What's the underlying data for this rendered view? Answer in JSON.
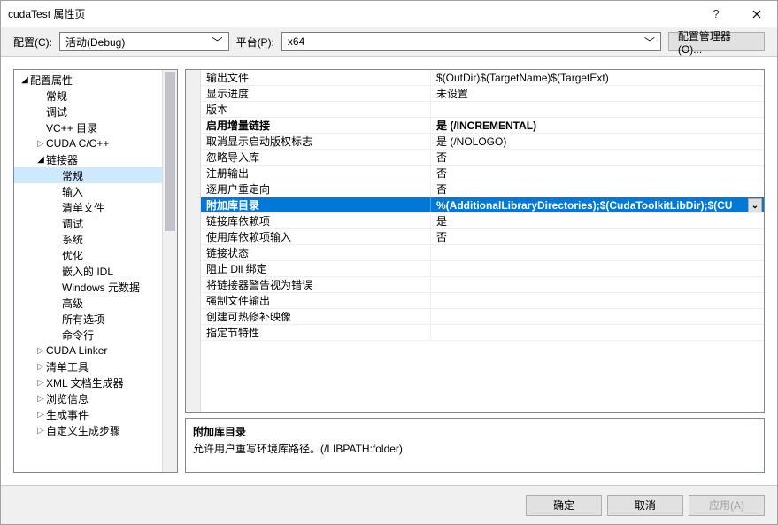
{
  "window": {
    "title": "cudaTest 属性页"
  },
  "toolbar": {
    "config_label": "配置(C):",
    "config_value": "活动(Debug)",
    "platform_label": "平台(P):",
    "platform_value": "x64",
    "manager_label": "配置管理器(O)..."
  },
  "tree": [
    {
      "label": "配置属性",
      "depth": 0,
      "arrow": "open"
    },
    {
      "label": "常规",
      "depth": 1,
      "arrow": ""
    },
    {
      "label": "调试",
      "depth": 1,
      "arrow": ""
    },
    {
      "label": "VC++ 目录",
      "depth": 1,
      "arrow": ""
    },
    {
      "label": "CUDA C/C++",
      "depth": 1,
      "arrow": "closed"
    },
    {
      "label": "链接器",
      "depth": 1,
      "arrow": "open"
    },
    {
      "label": "常规",
      "depth": 2,
      "arrow": "",
      "selected": true
    },
    {
      "label": "输入",
      "depth": 2,
      "arrow": ""
    },
    {
      "label": "清单文件",
      "depth": 2,
      "arrow": ""
    },
    {
      "label": "调试",
      "depth": 2,
      "arrow": ""
    },
    {
      "label": "系统",
      "depth": 2,
      "arrow": ""
    },
    {
      "label": "优化",
      "depth": 2,
      "arrow": ""
    },
    {
      "label": "嵌入的 IDL",
      "depth": 2,
      "arrow": ""
    },
    {
      "label": "Windows 元数据",
      "depth": 2,
      "arrow": ""
    },
    {
      "label": "高级",
      "depth": 2,
      "arrow": ""
    },
    {
      "label": "所有选项",
      "depth": 2,
      "arrow": ""
    },
    {
      "label": "命令行",
      "depth": 2,
      "arrow": ""
    },
    {
      "label": "CUDA Linker",
      "depth": 1,
      "arrow": "closed"
    },
    {
      "label": "清单工具",
      "depth": 1,
      "arrow": "closed"
    },
    {
      "label": "XML 文档生成器",
      "depth": 1,
      "arrow": "closed"
    },
    {
      "label": "浏览信息",
      "depth": 1,
      "arrow": "closed"
    },
    {
      "label": "生成事件",
      "depth": 1,
      "arrow": "closed"
    },
    {
      "label": "自定义生成步骤",
      "depth": 1,
      "arrow": "closed"
    }
  ],
  "grid": [
    {
      "k": "输出文件",
      "v": "$(OutDir)$(TargetName)$(TargetExt)"
    },
    {
      "k": "显示进度",
      "v": "未设置"
    },
    {
      "k": "版本",
      "v": ""
    },
    {
      "k": "启用增量链接",
      "v": "是 (/INCREMENTAL)",
      "bold": true
    },
    {
      "k": "取消显示启动版权标志",
      "v": "是 (/NOLOGO)"
    },
    {
      "k": "忽略导入库",
      "v": "否"
    },
    {
      "k": "注册输出",
      "v": "否"
    },
    {
      "k": "逐用户重定向",
      "v": "否"
    },
    {
      "k": "附加库目录",
      "v": "%(AdditionalLibraryDirectories);$(CudaToolkitLibDir);$(CU",
      "selected": true
    },
    {
      "k": "链接库依赖项",
      "v": "是"
    },
    {
      "k": "使用库依赖项输入",
      "v": "否"
    },
    {
      "k": "链接状态",
      "v": ""
    },
    {
      "k": "阻止 Dll 绑定",
      "v": ""
    },
    {
      "k": "将链接器警告视为错误",
      "v": ""
    },
    {
      "k": "强制文件输出",
      "v": ""
    },
    {
      "k": "创建可热修补映像",
      "v": ""
    },
    {
      "k": "指定节特性",
      "v": ""
    }
  ],
  "desc": {
    "title": "附加库目录",
    "text": "允许用户重写环境库路径。(/LIBPATH:folder)"
  },
  "footer": {
    "ok": "确定",
    "cancel": "取消",
    "apply": "应用(A)"
  }
}
